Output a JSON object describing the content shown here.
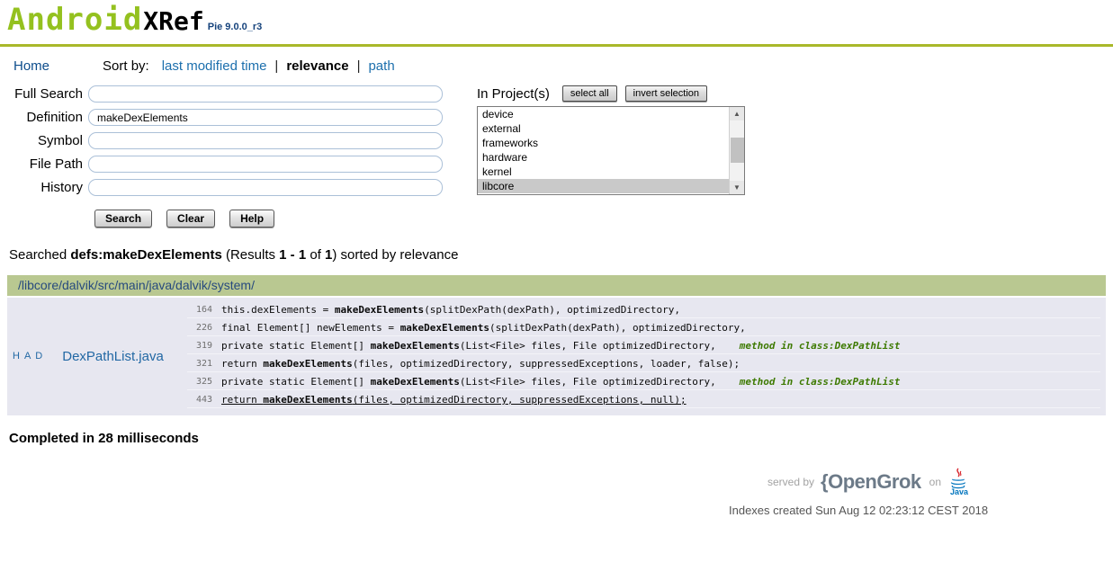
{
  "header": {
    "logo_android": "Android",
    "logo_xref": "XRef",
    "logo_version": "Pie 9.0.0_r3"
  },
  "nav": {
    "home": "Home",
    "sort_by": "Sort by:",
    "separator": "|",
    "options": [
      {
        "label": "last modified time",
        "active": false
      },
      {
        "label": "relevance",
        "active": true
      },
      {
        "label": "path",
        "active": false
      }
    ]
  },
  "search_form": {
    "fields": [
      {
        "label": "Full Search",
        "value": ""
      },
      {
        "label": "Definition",
        "value": "makeDexElements"
      },
      {
        "label": "Symbol",
        "value": ""
      },
      {
        "label": "File Path",
        "value": ""
      },
      {
        "label": "History",
        "value": ""
      }
    ],
    "buttons": {
      "search": "Search",
      "clear": "Clear",
      "help": "Help"
    }
  },
  "projects": {
    "label": "In Project(s)",
    "select_all": "select all",
    "invert_selection": "invert selection",
    "scroll_up_icon": "▲",
    "scroll_down_icon": "▼",
    "items": [
      {
        "name": "device",
        "selected": false
      },
      {
        "name": "external",
        "selected": false
      },
      {
        "name": "frameworks",
        "selected": false
      },
      {
        "name": "hardware",
        "selected": false
      },
      {
        "name": "kernel",
        "selected": false
      },
      {
        "name": "libcore",
        "selected": true
      }
    ]
  },
  "summary": {
    "prefix": "Searched ",
    "query": "defs:makeDexElements",
    "results_open": " (Results ",
    "range": "1 - 1",
    "of": " of ",
    "total": "1",
    "suffix": ") sorted by relevance"
  },
  "results": {
    "directory": "/libcore/dalvik/src/main/java/dalvik/system/",
    "file": {
      "history_links": [
        "H",
        "A",
        "D"
      ],
      "name": "DexPathList.java",
      "lines": [
        {
          "num": "164",
          "segments": [
            {
              "text": "this.dexElements = "
            },
            {
              "text": "makeDexElements",
              "bold": true
            },
            {
              "text": "(splitDexPath(dexPath), optimizedDirectory,"
            }
          ]
        },
        {
          "num": "226",
          "segments": [
            {
              "text": "final Element[] newElements = "
            },
            {
              "text": "makeDexElements",
              "bold": true
            },
            {
              "text": "(splitDexPath(dexPath), optimizedDirectory,"
            }
          ]
        },
        {
          "num": "319",
          "segments": [
            {
              "text": "private static Element[] "
            },
            {
              "text": "makeDexElements",
              "bold": true
            },
            {
              "text": "(List<File> files, File optimizedDirectory,"
            }
          ],
          "annotation": "method in class:DexPathList"
        },
        {
          "num": "321",
          "segments": [
            {
              "text": "return "
            },
            {
              "text": "makeDexElements",
              "bold": true
            },
            {
              "text": "(files, optimizedDirectory, suppressedExceptions, loader, false);"
            }
          ]
        },
        {
          "num": "325",
          "segments": [
            {
              "text": "private static Element[] "
            },
            {
              "text": "makeDexElements",
              "bold": true
            },
            {
              "text": "(List<File> files, File optimizedDirectory,"
            }
          ],
          "annotation": "method in class:DexPathList"
        },
        {
          "num": "443",
          "segments": [
            {
              "text": "return "
            },
            {
              "text": "makeDexElements",
              "bold": true
            },
            {
              "text": "(files, optimizedDirectory, suppressedExceptions, null);"
            }
          ],
          "underline": true
        }
      ]
    }
  },
  "footer": {
    "completed": "Completed in 28 milliseconds",
    "served_by": "served by",
    "opengrok": "{OpenGrok",
    "on": "on",
    "indexes": "Indexes created Sun Aug 12 02:23:12 CEST 2018"
  },
  "colors": {
    "brand_green": "#94c11f",
    "rule_olive": "#a9b82a",
    "link_blue": "#1c6fad",
    "navy": "#16437c",
    "dir_bar_bg": "#b9c891",
    "result_bg": "#e7e7f0",
    "selection_gray": "#c9c9c9",
    "annotation_green": "#3e7a02"
  }
}
